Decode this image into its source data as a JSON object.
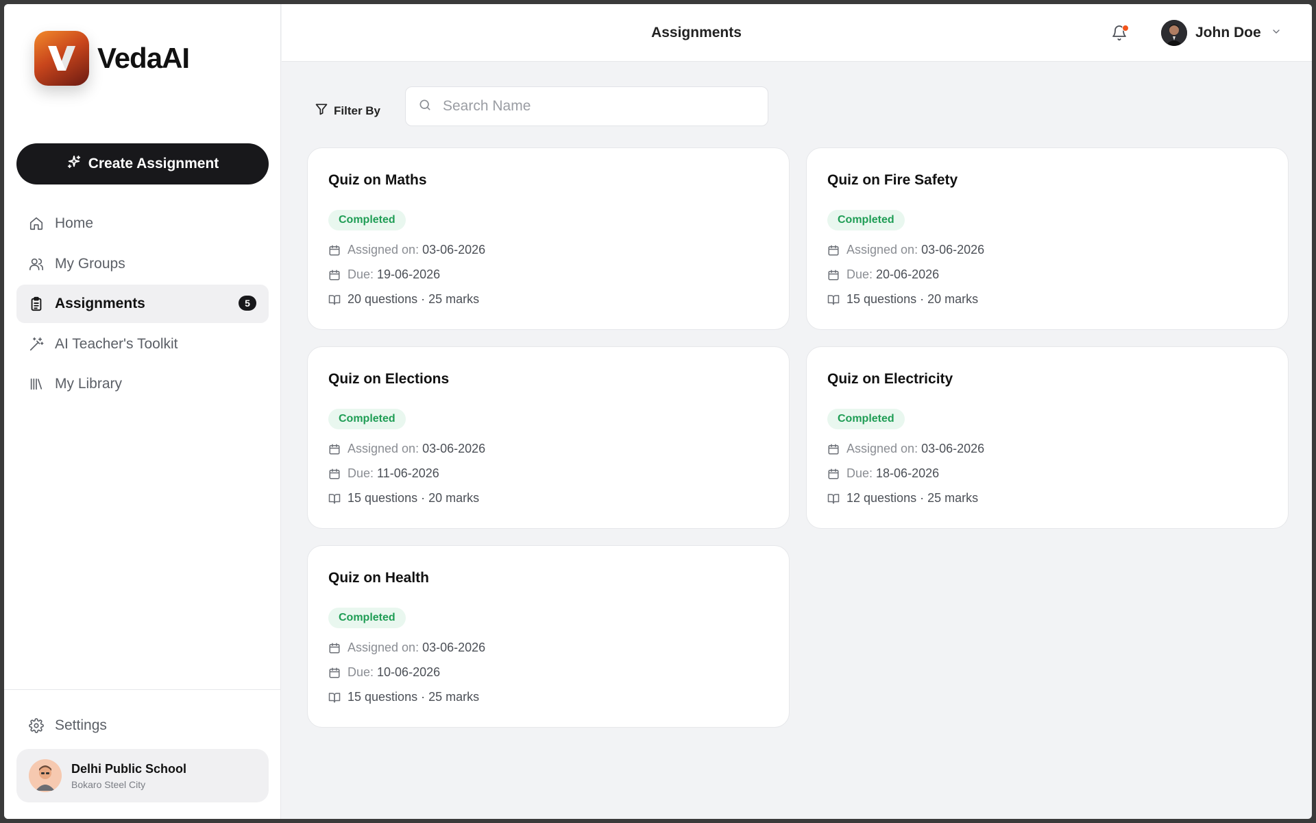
{
  "app": {
    "name": "VedaAI"
  },
  "sidebar": {
    "create_label": "Create Assignment",
    "items": [
      {
        "label": "Home",
        "icon": "home-icon"
      },
      {
        "label": "My Groups",
        "icon": "users-icon"
      },
      {
        "label": "Assignments",
        "icon": "clipboard-icon",
        "badge": "5",
        "active": true
      },
      {
        "label": "AI Teacher's Toolkit",
        "icon": "magic-wand-icon"
      },
      {
        "label": "My Library",
        "icon": "library-icon"
      }
    ],
    "settings_label": "Settings",
    "school": {
      "name": "Delhi Public School",
      "city": "Bokaro Steel City"
    }
  },
  "header": {
    "title": "Assignments",
    "user_name": "John Doe",
    "notification_dot_color": "#f2541b"
  },
  "toolbar": {
    "filter_label": "Filter By",
    "search_placeholder": "Search Name",
    "search_value": ""
  },
  "meta_labels": {
    "assigned": "Assigned on:",
    "due": "Due:"
  },
  "colors": {
    "status_bg": "#e9f7ef",
    "status_text": "#1f9d55",
    "primary_button": "#18181b"
  },
  "assignments": [
    {
      "title": "Quiz on Maths",
      "status": "Completed",
      "assigned_on": "03-06-2026",
      "due": "19-06-2026",
      "summary": "20 questions · 25 marks"
    },
    {
      "title": "Quiz on Fire Safety",
      "status": "Completed",
      "assigned_on": "03-06-2026",
      "due": "20-06-2026",
      "summary": "15 questions · 20 marks"
    },
    {
      "title": "Quiz on Elections",
      "status": "Completed",
      "assigned_on": "03-06-2026",
      "due": "11-06-2026",
      "summary": "15 questions · 20 marks"
    },
    {
      "title": "Quiz on Electricity",
      "status": "Completed",
      "assigned_on": "03-06-2026",
      "due": "18-06-2026",
      "summary": "12 questions · 25 marks"
    },
    {
      "title": "Quiz on Health",
      "status": "Completed",
      "assigned_on": "03-06-2026",
      "due": "10-06-2026",
      "summary": "15 questions · 25 marks"
    }
  ]
}
